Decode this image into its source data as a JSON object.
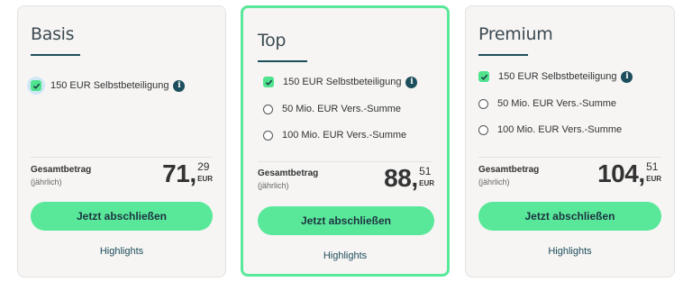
{
  "plans": [
    {
      "name": "Basis",
      "options": [
        {
          "label": "150 EUR Selbstbeteiligung",
          "checked": true,
          "info": true
        }
      ],
      "total_label": "Gesamtbetrag",
      "total_sub": "(jährlich)",
      "price_int": "71",
      "price_cents": "29",
      "currency": "EUR",
      "cta_label": "Jetzt abschließen",
      "highlights_label": "Highlights"
    },
    {
      "name": "Top",
      "selected": true,
      "options": [
        {
          "label": "150 EUR Selbstbeteiligung",
          "checked": true,
          "info": true
        },
        {
          "label": "50 Mio. EUR Vers.-Summe",
          "checked": false
        },
        {
          "label": "100 Mio. EUR Vers.-Summe",
          "checked": false
        }
      ],
      "total_label": "Gesamtbetrag",
      "total_sub": "(jährlich)",
      "price_int": "88",
      "price_cents": "51",
      "currency": "EUR",
      "cta_label": "Jetzt abschließen",
      "highlights_label": "Highlights"
    },
    {
      "name": "Premium",
      "options": [
        {
          "label": "150 EUR Selbstbeteiligung",
          "checked": true,
          "info": true
        },
        {
          "label": "50 Mio. EUR Vers.-Summe",
          "checked": false
        },
        {
          "label": "100 Mio. EUR Vers.-Summe",
          "checked": false
        }
      ],
      "total_label": "Gesamtbetrag",
      "total_sub": "(jährlich)",
      "price_int": "104",
      "price_cents": "51",
      "currency": "EUR",
      "cta_label": "Jetzt abschließen",
      "highlights_label": "Highlights"
    }
  ],
  "colors": {
    "accent": "#59e89a",
    "check": "#4fe38e",
    "brand_dark": "#1d4e5b",
    "card_bg": "#f6f5f4"
  },
  "icons": {
    "check": "check-icon",
    "info": "info-icon",
    "radio": "radio-icon"
  }
}
